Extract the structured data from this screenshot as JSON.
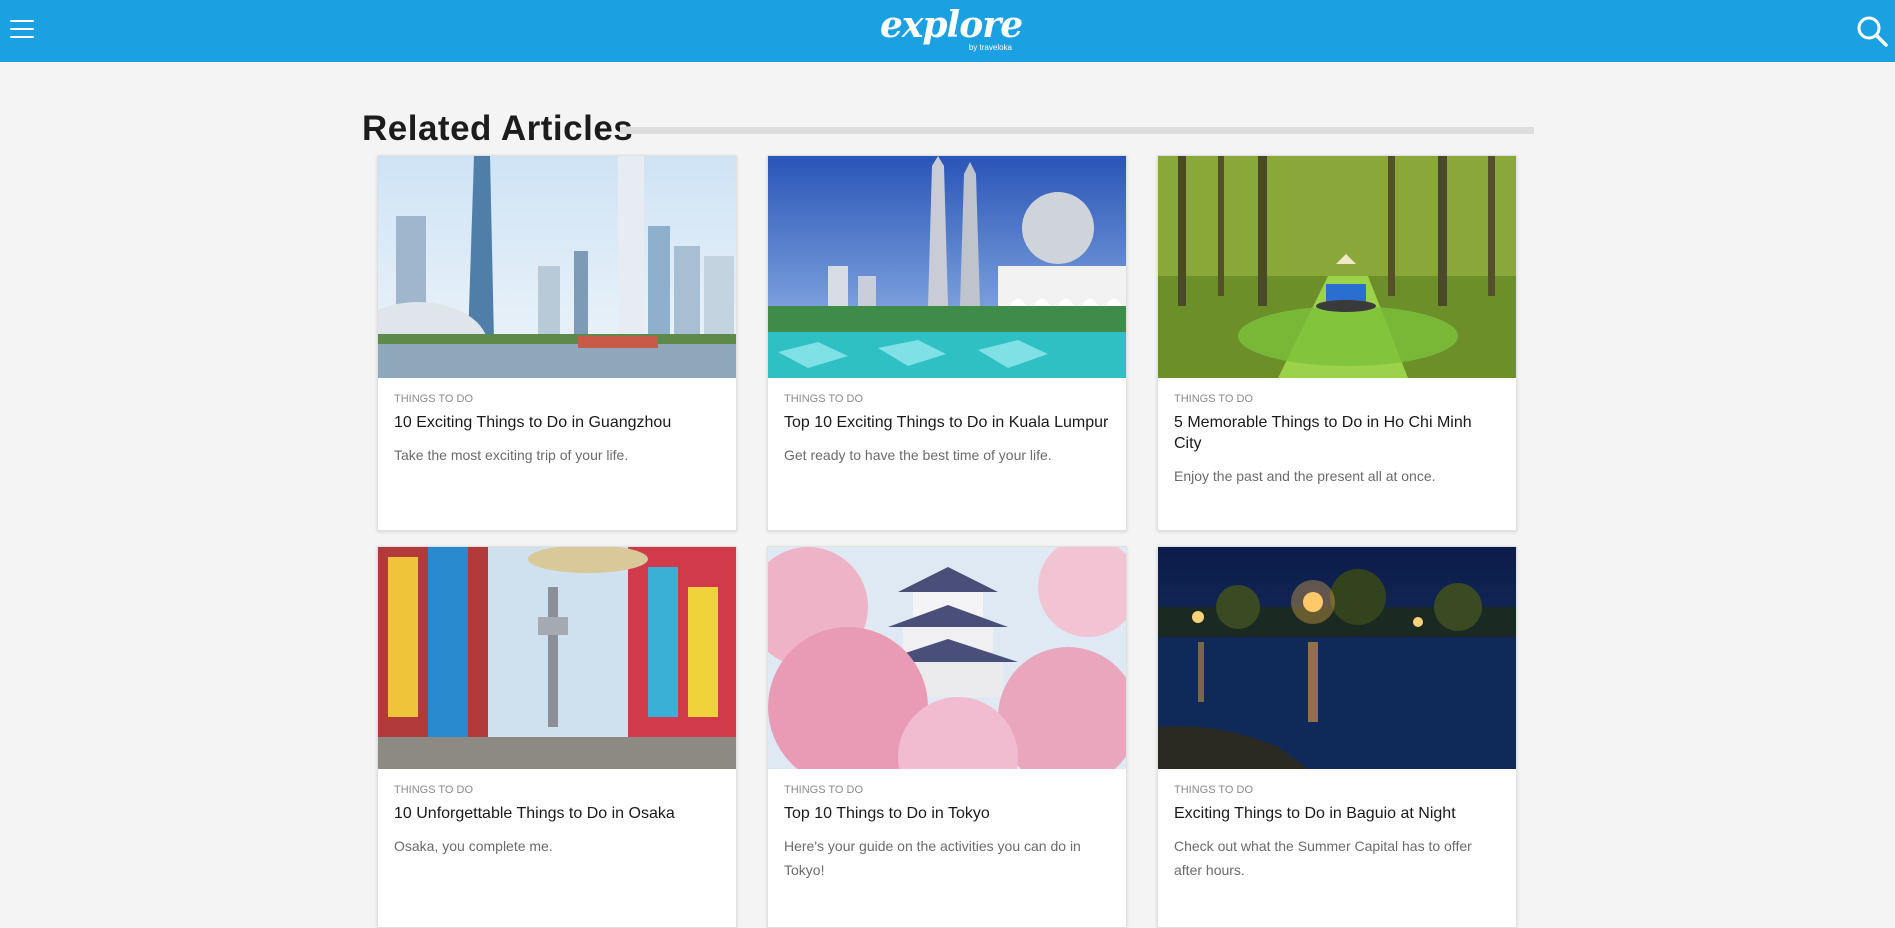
{
  "header": {
    "logo_text": "explore",
    "logo_sub": "by traveloka",
    "brand_color": "#1ba0e2",
    "menu_icon": "hamburger-menu-icon",
    "search_icon": "search-icon"
  },
  "section": {
    "title": "Related Articles"
  },
  "articles": [
    {
      "category": "THINGS TO DO",
      "title": "10 Exciting Things to Do in Guangzhou",
      "description": "Take the most exciting trip of your life.",
      "image": "guangzhou-skyline-photo"
    },
    {
      "category": "THINGS TO DO",
      "title": "Top 10 Exciting Things to Do in Kuala Lumpur",
      "description": "Get ready to have the best time of your life.",
      "image": "kuala-lumpur-towers-mosque-photo"
    },
    {
      "category": "THINGS TO DO",
      "title": "5 Memorable Things to Do in Ho Chi Minh City",
      "description": "Enjoy the past and the present all at once.",
      "image": "mangrove-forest-boat-photo"
    },
    {
      "category": "THINGS TO DO",
      "title": "10 Unforgettable Things to Do in Osaka",
      "description": "Osaka, you complete me.",
      "image": "osaka-tsutenkaku-street-photo"
    },
    {
      "category": "THINGS TO DO",
      "title": "Top 10 Things to Do in Tokyo",
      "description": "Here's your guide on the activities you can do in Tokyo!",
      "image": "japanese-castle-cherry-blossom-photo"
    },
    {
      "category": "THINGS TO DO",
      "title": "Exciting Things to Do in Baguio at Night",
      "description": "Check out what the Summer Capital has to offer after hours.",
      "image": "baguio-night-lake-photo"
    }
  ]
}
